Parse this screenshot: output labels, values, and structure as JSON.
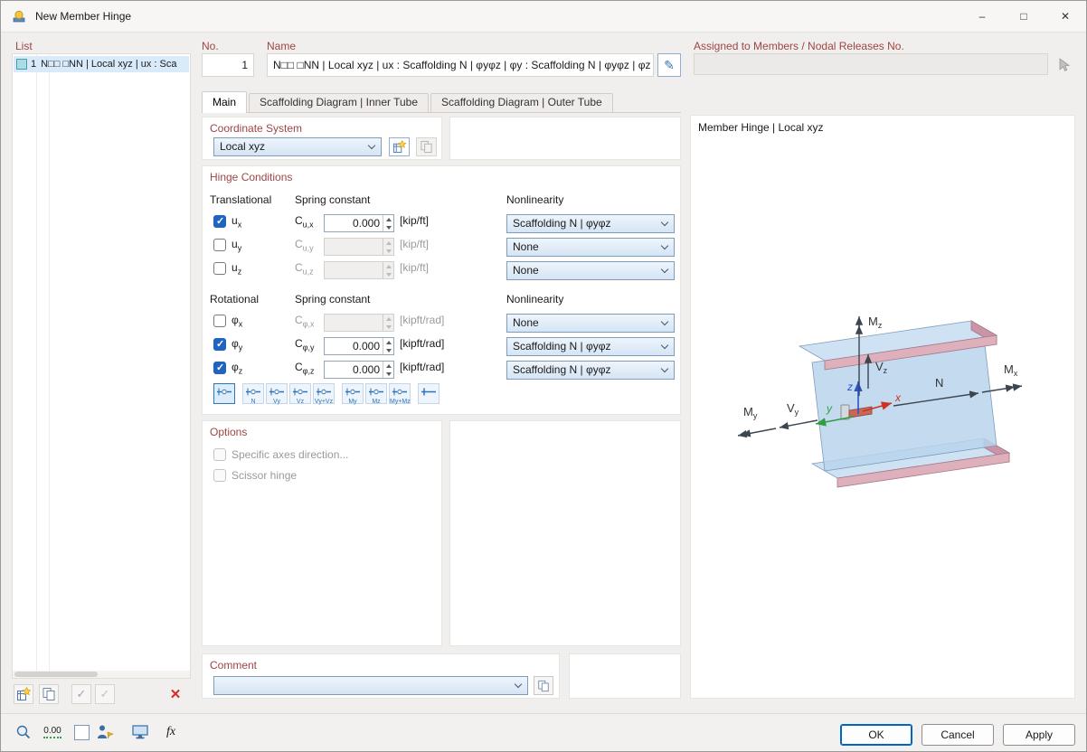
{
  "window": {
    "title": "New Member Hinge",
    "minimize_glyph": "–",
    "maximize_glyph": "□",
    "close_glyph": "✕"
  },
  "list_panel": {
    "label": "List",
    "item_number": "1",
    "item_text": "N□□ □NN | Local xyz | ux : Sca"
  },
  "header": {
    "no_label": "No.",
    "no_value": "1",
    "name_label": "Name",
    "name_value": "N□□ □NN | Local xyz | ux : Scaffolding N | φyφz | φy : Scaffolding N | φyφz | φz :",
    "assigned_label": "Assigned to Members / Nodal Releases No.",
    "assigned_value": ""
  },
  "tabs": {
    "main": "Main",
    "inner": "Scaffolding Diagram | Inner Tube",
    "outer": "Scaffolding Diagram | Outer Tube"
  },
  "coordinate_system": {
    "title": "Coordinate System",
    "selected": "Local xyz"
  },
  "hinge": {
    "title": "Hinge Conditions",
    "translational": "Translational",
    "rotational": "Rotational",
    "spring_constant": "Spring constant",
    "nonlinearity": "Nonlinearity",
    "rows": [
      {
        "sym": "u",
        "sub": "x",
        "checked": true,
        "c": "C",
        "csub": "u,x",
        "value": "0.000",
        "unit": "[kip/ft]",
        "nl": "Scaffolding N | φyφz",
        "enabled": true
      },
      {
        "sym": "u",
        "sub": "y",
        "checked": false,
        "c": "C",
        "csub": "u,y",
        "value": "",
        "unit": "[kip/ft]",
        "nl": "None",
        "enabled": false
      },
      {
        "sym": "u",
        "sub": "z",
        "checked": false,
        "c": "C",
        "csub": "u,z",
        "value": "",
        "unit": "[kip/ft]",
        "nl": "None",
        "enabled": false
      },
      {
        "sym": "φ",
        "sub": "x",
        "checked": false,
        "c": "C",
        "csub": "φ,x",
        "value": "",
        "unit": "[kipft/rad]",
        "nl": "None",
        "enabled": false
      },
      {
        "sym": "φ",
        "sub": "y",
        "checked": true,
        "c": "C",
        "csub": "φ,y",
        "value": "0.000",
        "unit": "[kipft/rad]",
        "nl": "Scaffolding N | φyφz",
        "enabled": true
      },
      {
        "sym": "φ",
        "sub": "z",
        "checked": true,
        "c": "C",
        "csub": "φ,z",
        "value": "0.000",
        "unit": "[kipft/rad]",
        "nl": "Scaffolding N | φyφz",
        "enabled": true
      }
    ],
    "presets": [
      {
        "name": "current",
        "label": ""
      },
      {
        "name": "n",
        "label": "N"
      },
      {
        "name": "vy",
        "label": "Vy"
      },
      {
        "name": "vz",
        "label": "Vz"
      },
      {
        "name": "vy-vz",
        "label": "Vy+Vz"
      },
      {
        "name": "my",
        "label": "My"
      },
      {
        "name": "mz",
        "label": "Mz"
      },
      {
        "name": "my-mz",
        "label": "My+Mz"
      },
      {
        "name": "rigid",
        "label": ""
      }
    ]
  },
  "options": {
    "title": "Options",
    "specific_axes": "Specific axes direction...",
    "scissor": "Scissor hinge"
  },
  "comment": {
    "title": "Comment",
    "value": ""
  },
  "preview": {
    "title": "Member Hinge | Local xyz",
    "labels": {
      "mz": {
        "main": "M",
        "sub": "z"
      },
      "vz": {
        "main": "V",
        "sub": "z"
      },
      "mx": {
        "main": "M",
        "sub": "x"
      },
      "n": {
        "main": "N",
        "sub": ""
      },
      "my": {
        "main": "M",
        "sub": "y"
      },
      "vy": {
        "main": "V",
        "sub": "y"
      },
      "x": "x",
      "y": "y",
      "z": "z"
    }
  },
  "footer": {
    "ok": "OK",
    "cancel": "Cancel",
    "apply": "Apply",
    "decimals_badge": "0.00",
    "fx_label": "fx"
  }
}
